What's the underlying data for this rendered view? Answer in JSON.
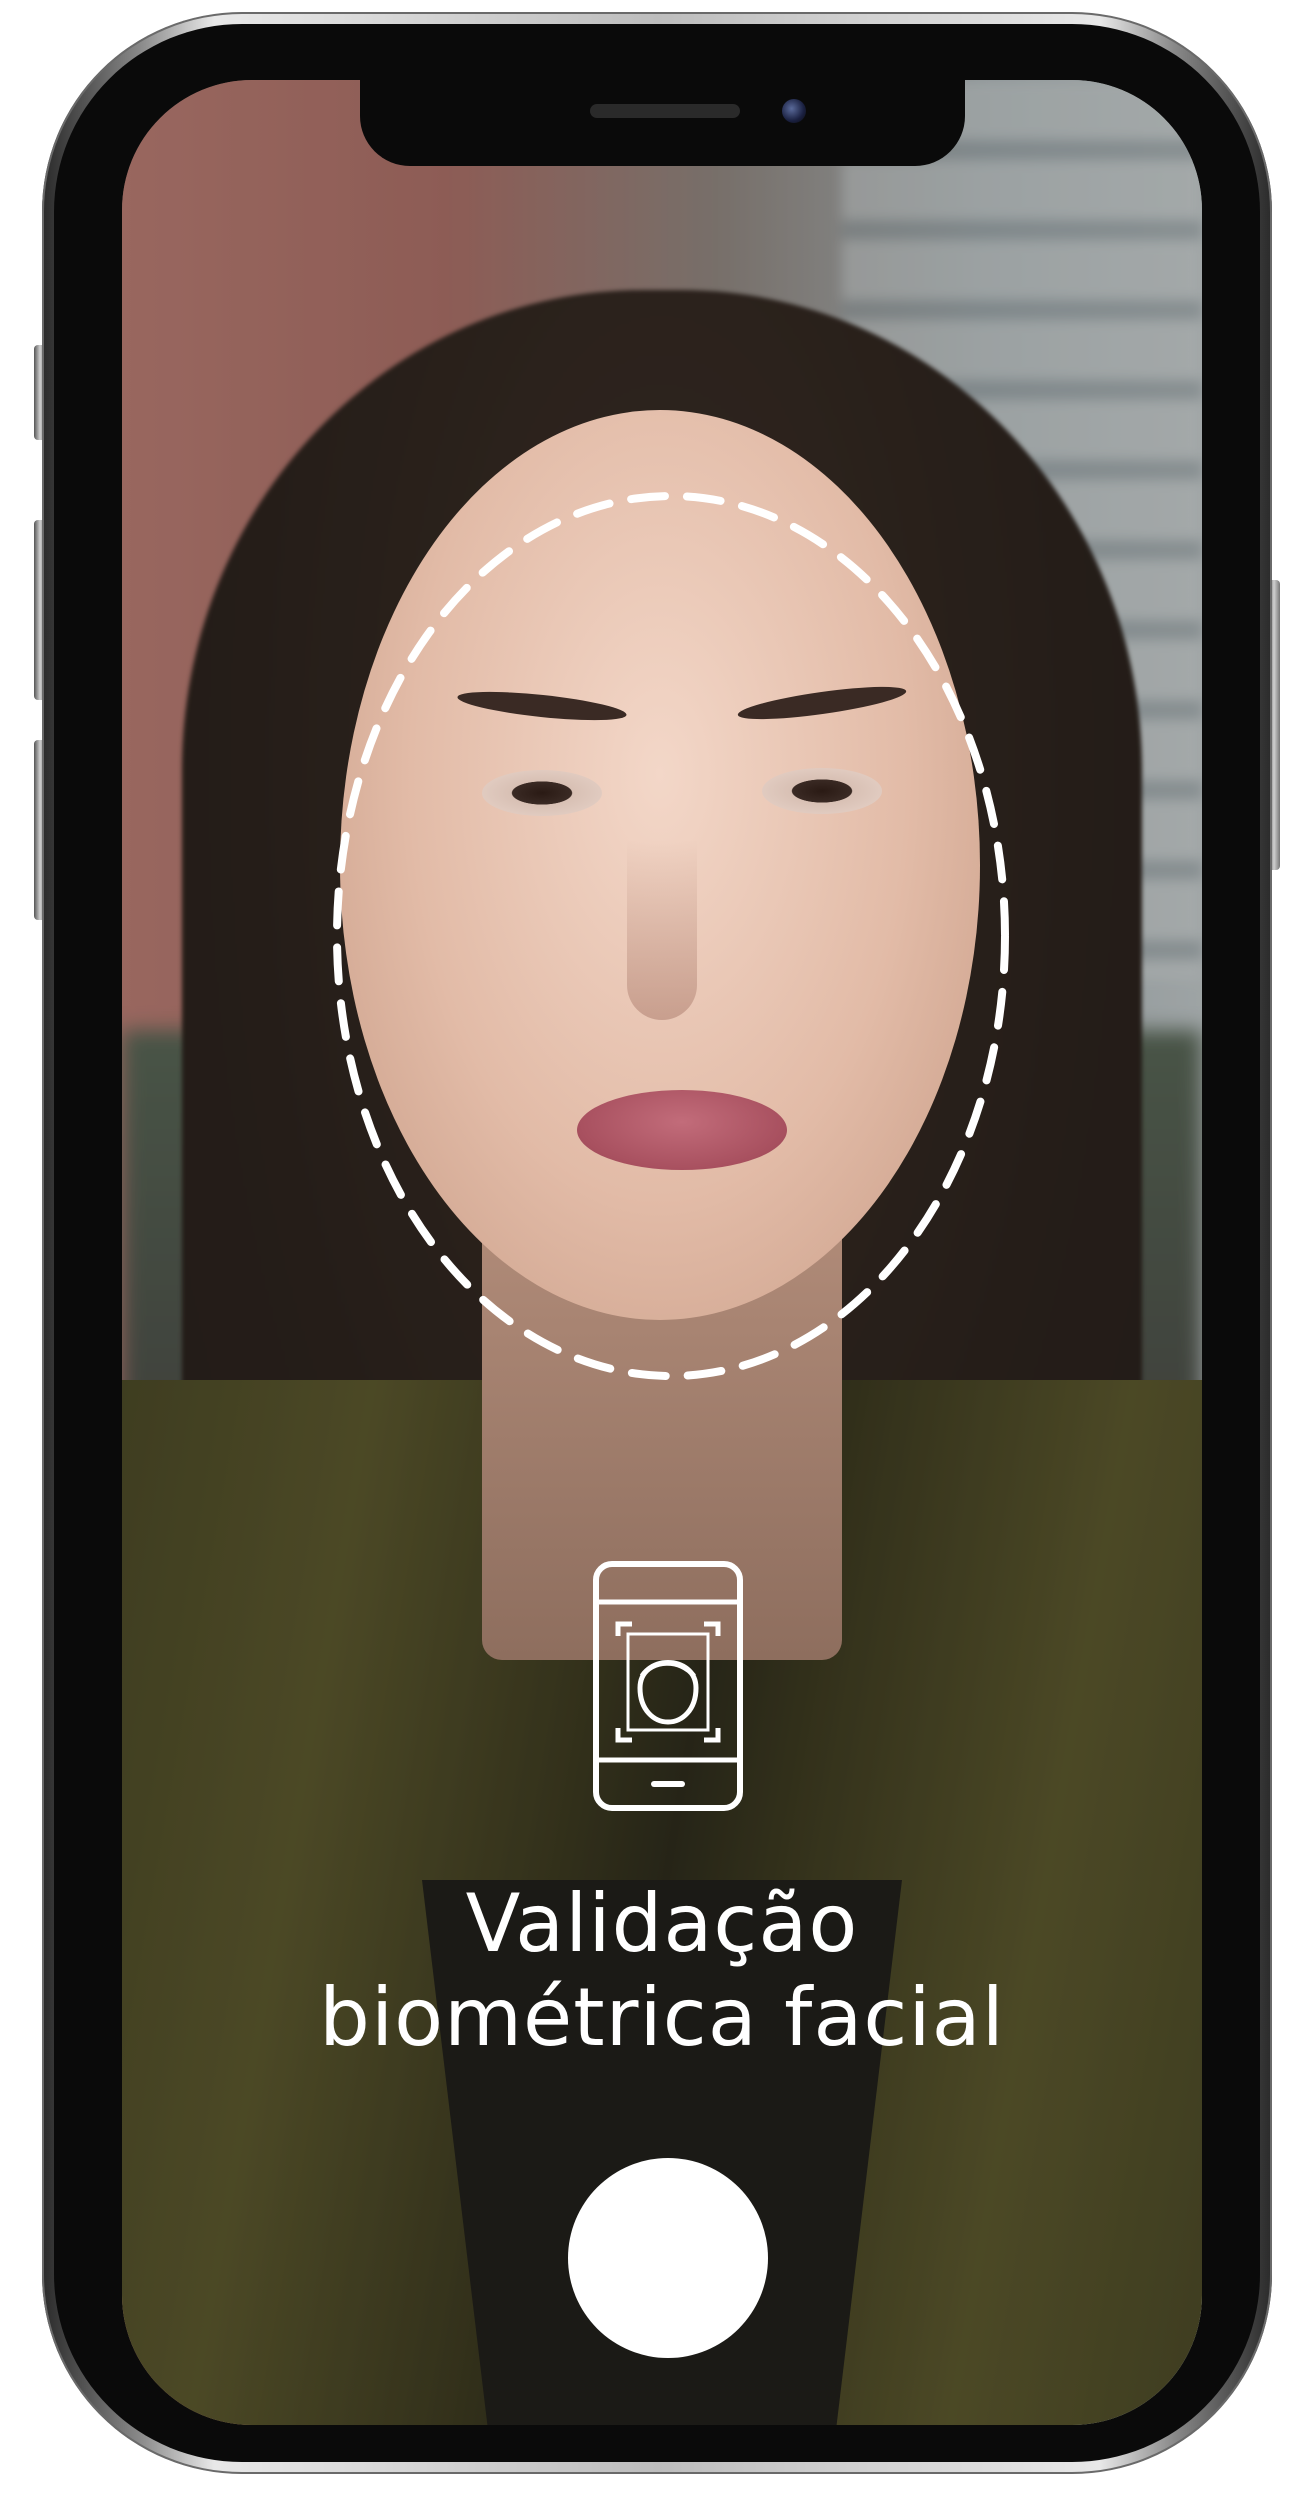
{
  "screen": {
    "title_line_1": "Validação",
    "title_line_2": "biométrica facial"
  },
  "icons": {
    "face_guide": "face-outline-guide",
    "biometric": "face-scan-phone-icon",
    "capture": "shutter-button"
  },
  "colors": {
    "text": "#ffffff",
    "guide_stroke": "#ffffff",
    "capture_button": "#ffffff",
    "device_frame": "#bdbdbd"
  }
}
